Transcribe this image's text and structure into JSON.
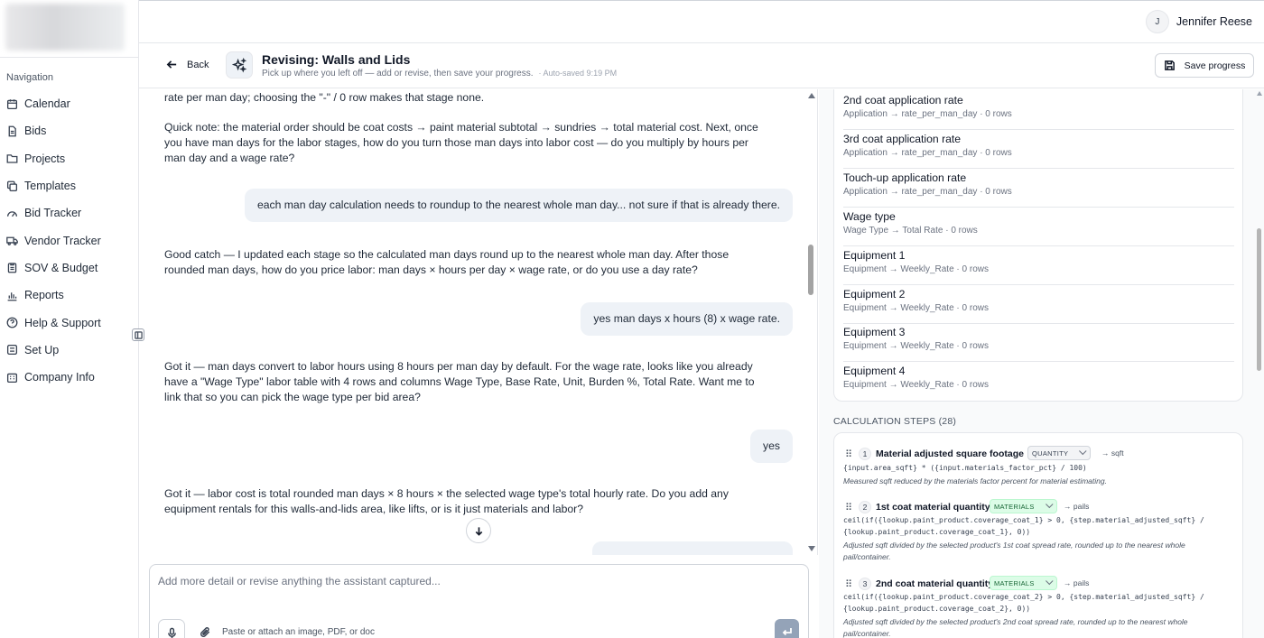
{
  "sidebar": {
    "nav_title": "Navigation",
    "items": [
      {
        "label": "Calendar",
        "icon": "calendar-icon"
      },
      {
        "label": "Bids",
        "icon": "document-icon"
      },
      {
        "label": "Projects",
        "icon": "folder-icon"
      },
      {
        "label": "Templates",
        "icon": "copy-icon"
      },
      {
        "label": "Bid Tracker",
        "icon": "gauge-icon"
      },
      {
        "label": "Vendor Tracker",
        "icon": "truck-icon"
      },
      {
        "label": "SOV & Budget",
        "icon": "clipboard-icon"
      },
      {
        "label": "Reports",
        "icon": "bar-chart-icon"
      },
      {
        "label": "Help & Support",
        "icon": "help-circle-icon"
      },
      {
        "label": "Set Up",
        "icon": "settings-icon"
      },
      {
        "label": "Company Info",
        "icon": "building-icon"
      }
    ]
  },
  "topbar": {
    "avatar_initial": "J",
    "user_name": "Jennifer Reese"
  },
  "header": {
    "back_label": "Back",
    "title": "Revising: Walls and Lids",
    "subtitle": "Pick up where you left off — add or revise, then save your progress.",
    "autosaved": "· Auto-saved 9:19 PM",
    "save_label": "Save progress"
  },
  "chat": {
    "messages": [
      {
        "role": "assistant",
        "text": "rate per man day; choosing the \"-\" / 0 row makes that stage none."
      },
      {
        "role": "assistant",
        "text": "Quick note: the material order should be coat costs → paint material subtotal → sundries → total material cost. Next, once you have man days for the labor stages, how do you turn those man days into labor cost — do you multiply by hours per man day and a wage rate?"
      },
      {
        "role": "user",
        "text": "each man day calculation needs to roundup to the nearest whole man day... not sure if that is already there."
      },
      {
        "role": "assistant",
        "text": "Good catch — I updated each stage so the calculated man days round up to the nearest whole man day. After those rounded man days, how do you price labor: man days × hours per day × wage rate, or do you use a day rate?"
      },
      {
        "role": "user",
        "text": "yes man days x hours (8) x wage rate."
      },
      {
        "role": "assistant",
        "text": "Got it — man days convert to labor hours using 8 hours per man day by default. For the wage rate, looks like you already have a \"Wage Type\" labor table with 4 rows and columns Wage Type, Base Rate, Unit, Burden %, Total Rate. Want me to link that so you can pick the wage type per bid area?"
      },
      {
        "role": "user",
        "text": "yes"
      },
      {
        "role": "assistant",
        "text": "Got it — labor cost is total rounded man days × 8 hours × the selected wage type's total hourly rate. Do you add any equipment rentals for this walls-and-lids area, like lifts, or is it just materials and labor?"
      }
    ]
  },
  "composer": {
    "placeholder": "Add more detail or revise anything the assistant captured...",
    "attach_hint": "Paste or attach an image, PDF, or doc"
  },
  "fields": [
    {
      "name": "2nd coat application rate",
      "meta": "Application → rate_per_man_day · 0 rows"
    },
    {
      "name": "3rd coat application rate",
      "meta": "Application → rate_per_man_day · 0 rows"
    },
    {
      "name": "Touch-up application rate",
      "meta": "Application → rate_per_man_day · 0 rows"
    },
    {
      "name": "Wage type",
      "meta": "Wage Type → Total Rate · 0 rows"
    },
    {
      "name": "Equipment 1",
      "meta": "Equipment → Weekly_Rate · 0 rows"
    },
    {
      "name": "Equipment 2",
      "meta": "Equipment → Weekly_Rate · 0 rows"
    },
    {
      "name": "Equipment 3",
      "meta": "Equipment → Weekly_Rate · 0 rows"
    },
    {
      "name": "Equipment 4",
      "meta": "Equipment → Weekly_Rate · 0 rows"
    }
  ],
  "calc": {
    "title": "CALCULATION STEPS (28)",
    "steps": [
      {
        "num": "1",
        "name": "Material adjusted square footage",
        "type": "QUANTITY",
        "unit": "→ sqft",
        "formula": "{input.area_sqft} * ({input.materials_factor_pct} / 100)",
        "desc": "Measured sqft reduced by the materials factor percent for material estimating."
      },
      {
        "num": "2",
        "name": "1st coat material quantity",
        "type": "MATERIALS",
        "unit": "→ pails",
        "formula": "ceil(if({lookup.paint_product.coverage_coat_1} > 0, {step.material_adjusted_sqft} / {lookup.paint_product.coverage_coat_1}, 0))",
        "desc": "Adjusted sqft divided by the selected product's 1st coat spread rate, rounded up to the nearest whole pail/container."
      },
      {
        "num": "3",
        "name": "2nd coat material quantity",
        "type": "MATERIALS",
        "unit": "→ pails",
        "formula": "ceil(if({lookup.paint_product.coverage_coat_2} > 0, {step.material_adjusted_sqft} / {lookup.paint_product.coverage_coat_2}, 0))",
        "desc": "Adjusted sqft divided by the selected product's 2nd coat spread rate, rounded up to the nearest whole pail/container."
      }
    ]
  },
  "colors": {
    "accent_user_bubble": "#eef2f7",
    "materials_pill": "#dcfce7",
    "send_button": "#94a3b8"
  }
}
